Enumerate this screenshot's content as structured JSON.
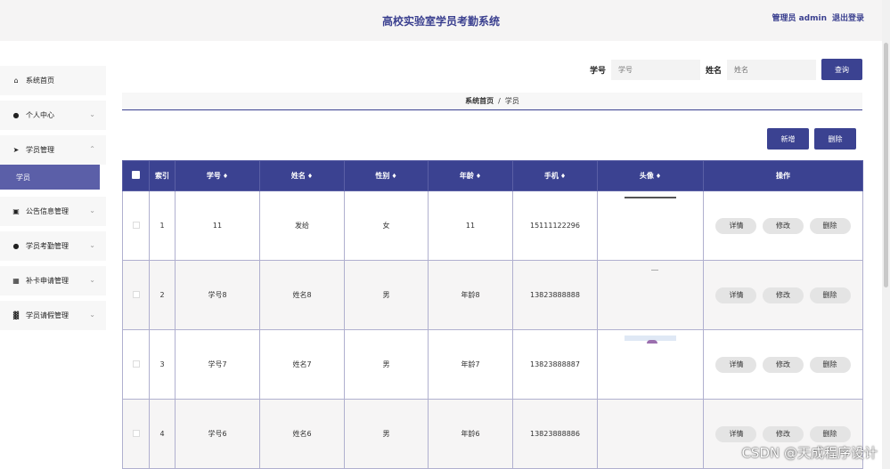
{
  "header": {
    "title": "高校实验室学员考勤系统",
    "admin_label": "管理员 admin",
    "logout_label": "退出登录"
  },
  "sidebar": {
    "items": [
      {
        "label": "系统首页",
        "icon": "home-icon",
        "has_chevron": false
      },
      {
        "label": "个人中心",
        "icon": "user-icon",
        "has_chevron": true
      },
      {
        "label": "学员管理",
        "icon": "send-icon",
        "has_chevron": true,
        "open": true
      },
      {
        "label": "公告信息管理",
        "icon": "message-icon",
        "has_chevron": true
      },
      {
        "label": "学员考勤管理",
        "icon": "user-icon",
        "has_chevron": true
      },
      {
        "label": "补卡申请管理",
        "icon": "grid-icon",
        "has_chevron": true
      },
      {
        "label": "学员请假管理",
        "icon": "chart-icon",
        "has_chevron": true
      }
    ],
    "active_sub": "学员"
  },
  "search": {
    "student_id_label": "学号",
    "student_id_placeholder": "学号",
    "name_label": "姓名",
    "name_placeholder": "姓名",
    "button": "查询"
  },
  "breadcrumb": {
    "home": "系统首页",
    "separator": "/",
    "current": "学员"
  },
  "actions": {
    "add": "新增",
    "delete": "删除"
  },
  "table": {
    "columns": [
      "索引",
      "学号",
      "姓名",
      "性别",
      "年龄",
      "手机",
      "头像",
      "操作"
    ],
    "sortable": [
      false,
      true,
      true,
      true,
      true,
      true,
      true,
      false
    ],
    "rows": [
      {
        "index": "1",
        "student_id": "11",
        "name": "发给",
        "gender": "女",
        "age": "11",
        "phone": "15111122296"
      },
      {
        "index": "2",
        "student_id": "学号8",
        "name": "姓名8",
        "gender": "男",
        "age": "年龄8",
        "phone": "13823888888"
      },
      {
        "index": "3",
        "student_id": "学号7",
        "name": "姓名7",
        "gender": "男",
        "age": "年龄7",
        "phone": "13823888887"
      },
      {
        "index": "4",
        "student_id": "学号6",
        "name": "姓名6",
        "gender": "男",
        "age": "年龄6",
        "phone": "13823888886"
      }
    ],
    "row_actions": {
      "detail": "详情",
      "edit": "修改",
      "delete": "删除"
    }
  },
  "watermark": "CSDN @天成程序设计",
  "colors": {
    "primary": "#3b4291",
    "sidebar_active": "#5b5fa8",
    "title": "#3a3f8f"
  }
}
